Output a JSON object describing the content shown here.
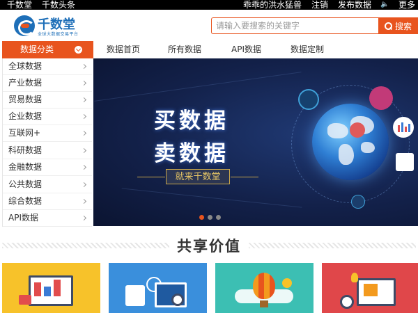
{
  "topbar": {
    "left_links": [
      "千数堂",
      "千数头条"
    ],
    "username": "乖乖的洪水猛兽",
    "logout": "注销",
    "publish": "发布数据",
    "sound_icon": "speaker-icon",
    "more": "更多"
  },
  "header": {
    "logo_name": "千数堂",
    "logo_tagline": "全球大数据交易平台",
    "search_placeholder": "请输入要搜索的关键字",
    "search_button": "搜索"
  },
  "nav": {
    "category_label": "数据分类",
    "items": [
      "数据首页",
      "所有数据",
      "API数据",
      "数据定制"
    ]
  },
  "sidebar": {
    "items": [
      "全球数据",
      "产业数据",
      "贸易数据",
      "企业数据",
      "互联网+",
      "科研数据",
      "金融数据",
      "公共数据",
      "综合数据",
      "API数据"
    ]
  },
  "banner": {
    "title_line1": "买数据",
    "title_line2": "卖数据",
    "subtitle": "就来千数堂",
    "slide_count": 3,
    "active_slide": 1
  },
  "section": {
    "title": "共享价值"
  },
  "cards": [
    {
      "color": "#f7c22a",
      "scene": "dashboard-illustration"
    },
    {
      "color": "#3a8fdc",
      "scene": "science-illustration"
    },
    {
      "color": "#3cbfb3",
      "scene": "balloon-illustration"
    },
    {
      "color": "#e0474a",
      "scene": "workspace-illustration"
    }
  ],
  "colors": {
    "accent": "#e8541e",
    "brand_blue": "#1e6fb8",
    "banner_bg": "#13214a"
  }
}
